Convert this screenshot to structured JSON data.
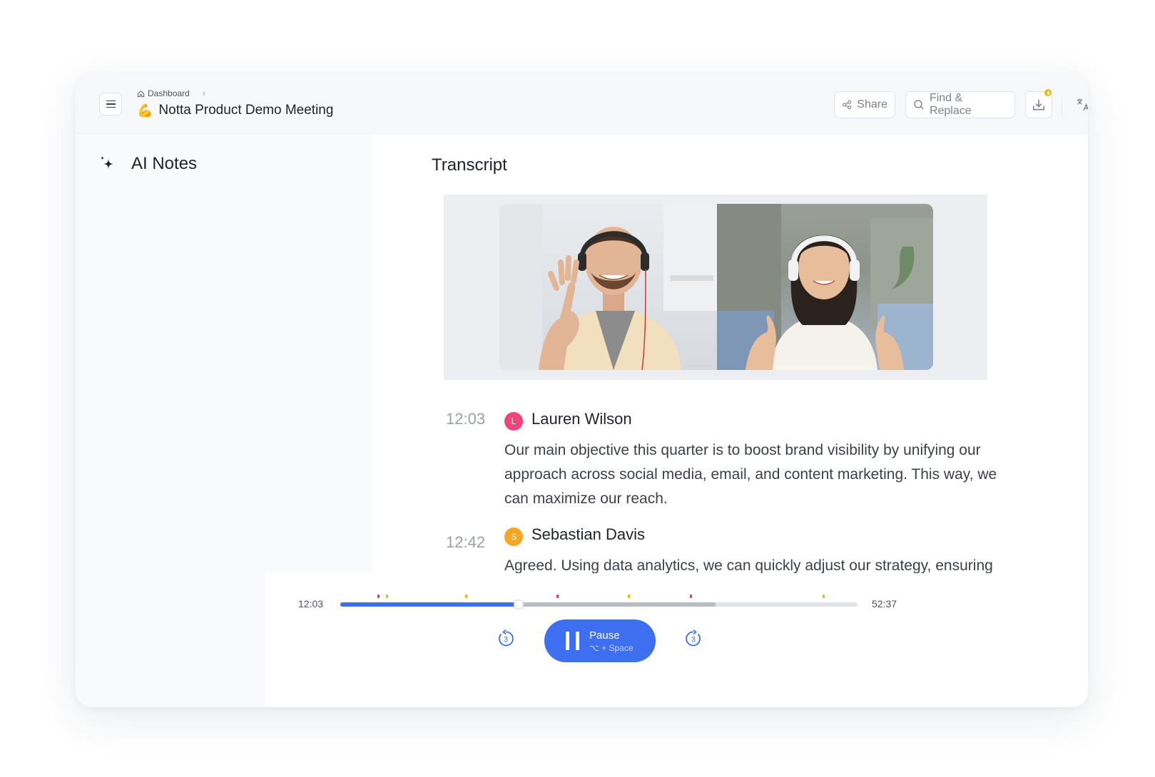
{
  "header": {
    "breadcrumb": "Dashboard",
    "title_emoji": "💪",
    "title": "Notta Product Demo Meeting",
    "share_label": "Share",
    "find_label": "Find & Replace"
  },
  "left_panel": {
    "title": "AI Notes"
  },
  "transcript": {
    "title": "Transcript",
    "entries": [
      {
        "time": "12:03",
        "initial": "L",
        "speaker": "Lauren Wilson",
        "color": "#f0457a",
        "text_lines": [
          "Our main objective this quarter is to boost brand visibility by unifying our",
          "approach across social media, email, and content marketing. This way, we",
          "can maximize our reach."
        ]
      },
      {
        "time": "12:42",
        "initial": "S",
        "speaker": "Sebastian Davis",
        "color": "#f5a623",
        "text_lines": [
          "Agreed. Using data analytics, we can quickly adjust our strategy, ensuring"
        ]
      }
    ]
  },
  "player": {
    "current_time": "12:03",
    "total_time": "52:37",
    "progress_fraction": 0.345,
    "buffer_fraction": 0.725,
    "skip_back_seconds": "3",
    "skip_forward_seconds": "3",
    "pause_label": "Pause",
    "pause_hint": "⌥ + Space",
    "marker_fractions": [
      0.074,
      0.09,
      0.243,
      0.42,
      0.558,
      0.678,
      0.935
    ],
    "marker_colors": [
      "#e8336b",
      "#f5b400",
      "#f5b400",
      "#e8336b",
      "#f5b400",
      "#e8336b",
      "#f5b400"
    ]
  },
  "colors": {
    "accent": "#3d6ff0",
    "badge": "#f7b500"
  }
}
